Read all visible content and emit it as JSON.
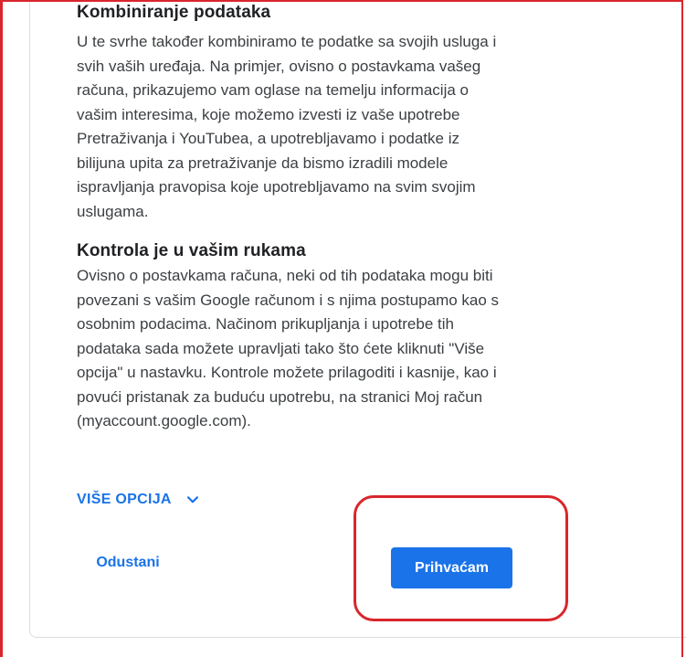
{
  "section1": {
    "title": "Kombiniranje podataka",
    "text": "U te svrhe također kombiniramo te podatke sa svojih usluga i svih vaših uređaja. Na primjer, ovisno o postavkama vašeg računa, prikazujemo vam oglase na temelju informacija o vašim interesima, koje možemo izvesti iz vaše upotrebe Pretraživanja i YouTubea, a upotrebljavamo i podatke iz bilijuna upita za pretraživanje da bismo izradili modele ispravljanja pravopisa koje upotrebljavamo na svim svojim uslugama."
  },
  "section2": {
    "title": "Kontrola je u vašim rukama",
    "text": "Ovisno o postavkama računa, neki od tih podataka mogu biti povezani s vašim Google računom i s njima postupamo kao s osobnim podacima. Načinom prikupljanja i upotrebe tih podataka sada možete upravljati tako što ćete kliknuti \"Više opcija\" u nastavku. Kontrole možete prilagoditi i kasnije, kao i povući pristanak za buduću upotrebu, na stranici Moj račun (myaccount.google.com)."
  },
  "actions": {
    "more_options_label": "VIŠE OPCIJA",
    "cancel_label": "Odustani",
    "accept_label": "Prihvaćam"
  },
  "icons": {
    "more_options": "chevron-down-icon"
  },
  "colors": {
    "accent": "#1a73e8",
    "annotation": "#d9262c",
    "heading": "#202124",
    "body_text": "#3c4043"
  }
}
